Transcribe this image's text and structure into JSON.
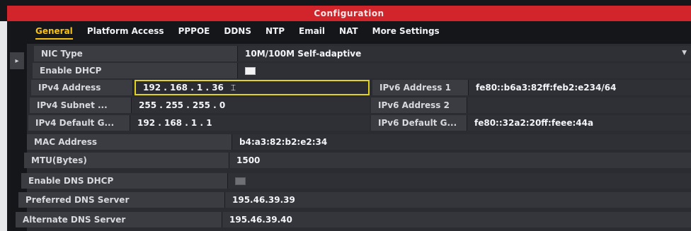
{
  "window": {
    "title": "Configuration"
  },
  "tabs": [
    {
      "label": "General",
      "active": true
    },
    {
      "label": "Platform Access",
      "active": false
    },
    {
      "label": "PPPOE",
      "active": false
    },
    {
      "label": "DDNS",
      "active": false
    },
    {
      "label": "NTP",
      "active": false
    },
    {
      "label": "Email",
      "active": false
    },
    {
      "label": "NAT",
      "active": false
    },
    {
      "label": "More Settings",
      "active": false
    }
  ],
  "nic": {
    "label": "NIC Type",
    "value": "10M/100M Self-adaptive",
    "dropdown_icon": "chevron-down-icon"
  },
  "dhcp": {
    "label": "Enable DHCP",
    "checked": false
  },
  "ipv4": {
    "address_label": "IPv4 Address",
    "address_value": "192 . 168 . 1     . 36",
    "subnet_label": "IPv4 Subnet ...",
    "subnet_value": "255 . 255 . 255 . 0",
    "gateway_label": "IPv4 Default G...",
    "gateway_value": "192 . 168 . 1     . 1"
  },
  "ipv6": {
    "address1_label": "IPv6 Address 1",
    "address1_value": "fe80::b6a3:82ff:feb2:e234/64",
    "address2_label": "IPv6 Address 2",
    "address2_value": "",
    "gateway_label": "IPv6 Default G...",
    "gateway_value": "fe80::32a2:20ff:feee:44a"
  },
  "mac": {
    "label": "MAC Address",
    "value": "b4:a3:82:b2:e2:34"
  },
  "mtu": {
    "label": "MTU(Bytes)",
    "value": "1500"
  },
  "dns_dhcp": {
    "label": "Enable DNS DHCP",
    "checked": false
  },
  "dns_preferred": {
    "label": "Preferred DNS Server",
    "value": "195.46.39.39"
  },
  "dns_alternate": {
    "label": "Alternate DNS Server",
    "value": "195.46.39.40"
  },
  "icons": {
    "collapse": "chevron-right-icon",
    "text_cursor": "text-cursor-icon"
  },
  "colors": {
    "title_bar": "#d2242b",
    "active_tab": "#f6c216",
    "focus_border": "#e1d21e"
  }
}
